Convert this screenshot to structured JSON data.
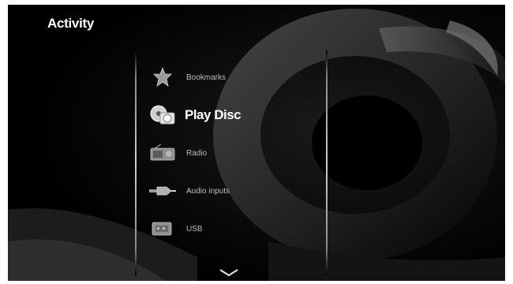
{
  "screen": {
    "title": "Activity"
  },
  "menu": {
    "items": [
      {
        "label": "Bookmarks",
        "icon": "star-icon",
        "selected": false
      },
      {
        "label": "Play Disc",
        "icon": "disc-icon",
        "selected": true
      },
      {
        "label": "Radio",
        "icon": "radio-icon",
        "selected": false
      },
      {
        "label": "Audio inputs",
        "icon": "audio-input-icon",
        "selected": false
      },
      {
        "label": "USB",
        "icon": "usb-icon",
        "selected": false
      }
    ]
  },
  "colors": {
    "background": "#000000",
    "text_selected": "#ffffff",
    "text_normal": "#bdbdbd"
  }
}
